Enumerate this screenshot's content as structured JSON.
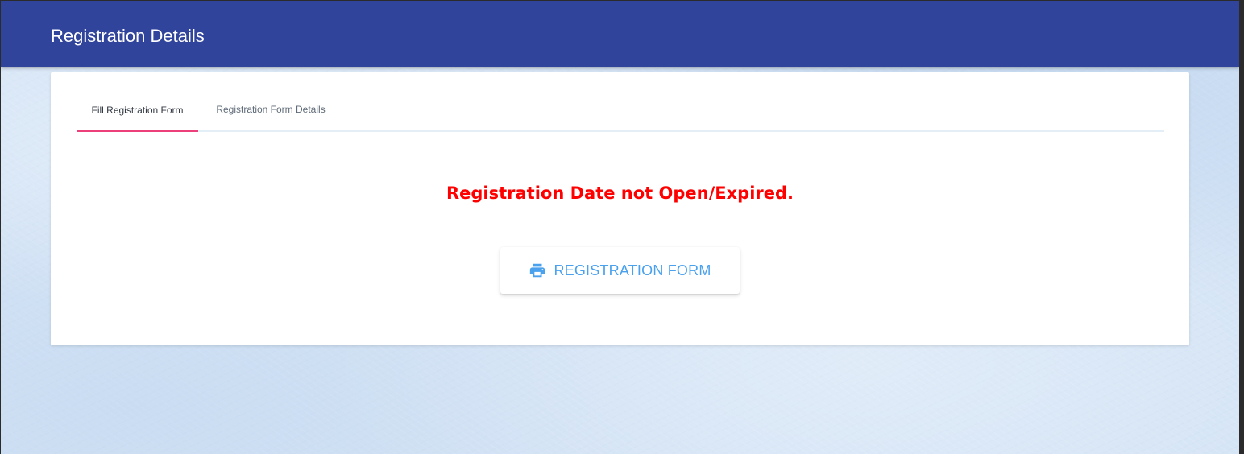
{
  "header": {
    "title": "Registration Details"
  },
  "tabs": [
    {
      "label": "Fill Registration Form",
      "active": true
    },
    {
      "label": "Registration Form Details",
      "active": false
    }
  ],
  "content": {
    "status_message": "Registration Date not Open/Expired.",
    "button": {
      "label": "REGISTRATION FORM",
      "icon": "printer-icon"
    }
  },
  "colors": {
    "app_bar": "#31449b",
    "active_tab_indicator": "#ec407a",
    "status_message": "#ff0000",
    "button_text": "#4aa1ee"
  }
}
